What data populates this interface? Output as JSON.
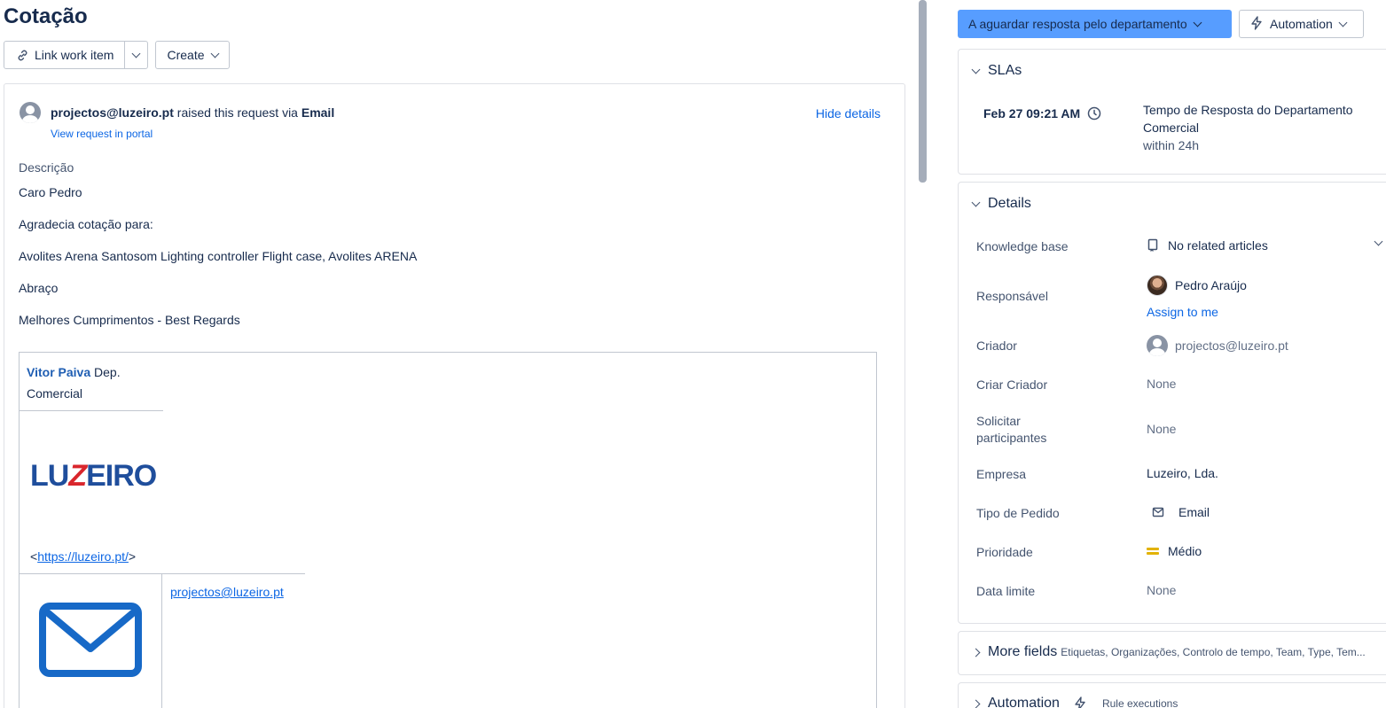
{
  "left": {
    "title": "Cotação",
    "toolbar": {
      "link_work_item": "Link work item",
      "create": "Create"
    },
    "request": {
      "reporter_email": "projectos@luzeiro.pt",
      "raised_text": " raised this request via ",
      "channel": "Email",
      "view_portal": "View request in portal",
      "hide_details": "Hide details"
    },
    "description": {
      "label": "Descrição",
      "lines": [
        "Caro Pedro",
        "Agradecia cotação para:",
        "Avolites Arena Santosom Lighting controller Flight case, Avolites ARENA",
        "Abraço",
        "Melhores Cumprimentos - Best Regards"
      ]
    },
    "signature": {
      "name": "Vitor Paiva",
      "dept_1": " Dep.",
      "dept_2": "Comercial",
      "logo_part1": "LU",
      "logo_z": "Z",
      "logo_part2": "EIRO",
      "url_prefix": "<",
      "url": "https://luzeiro.pt/",
      "url_suffix": ">",
      "email": "projectos@luzeiro.pt"
    }
  },
  "right": {
    "status": "A aguardar resposta pelo departamento",
    "automation_btn": "Automation",
    "slas": {
      "title": "SLAs",
      "time": "Feb 27 09:21 AM",
      "name": "Tempo de Resposta do Departamento Comercial",
      "within": "within 24h"
    },
    "details": {
      "title": "Details",
      "knowledge_base": {
        "label": "Knowledge base",
        "value": "No related articles"
      },
      "responsavel": {
        "label": "Responsável",
        "value": "Pedro Araújo",
        "assign": "Assign to me"
      },
      "criador": {
        "label": "Criador",
        "value": "projectos@luzeiro.pt"
      },
      "criar_criador": {
        "label": "Criar Criador",
        "value": "None"
      },
      "solicitar": {
        "label_1": "Solicitar",
        "label_2": "participantes",
        "value": "None"
      },
      "empresa": {
        "label": "Empresa",
        "value": "Luzeiro, Lda."
      },
      "tipo_pedido": {
        "label": "Tipo de Pedido",
        "value": "Email"
      },
      "prioridade": {
        "label": "Prioridade",
        "value": "Médio",
        "color": "#e2b203"
      },
      "data_limite": {
        "label": "Data limite",
        "value": "None"
      }
    },
    "more_fields": {
      "title": "More fields",
      "subtitle": "Etiquetas, Organizações, Controlo de tempo, Team, Type, Tem..."
    },
    "automation_panel": {
      "title": "Automation",
      "subtitle": "Rule executions"
    }
  },
  "colors": {
    "status_bg": "#579dff",
    "link": "#0c66e4",
    "priority_medium": "#e2b203"
  }
}
